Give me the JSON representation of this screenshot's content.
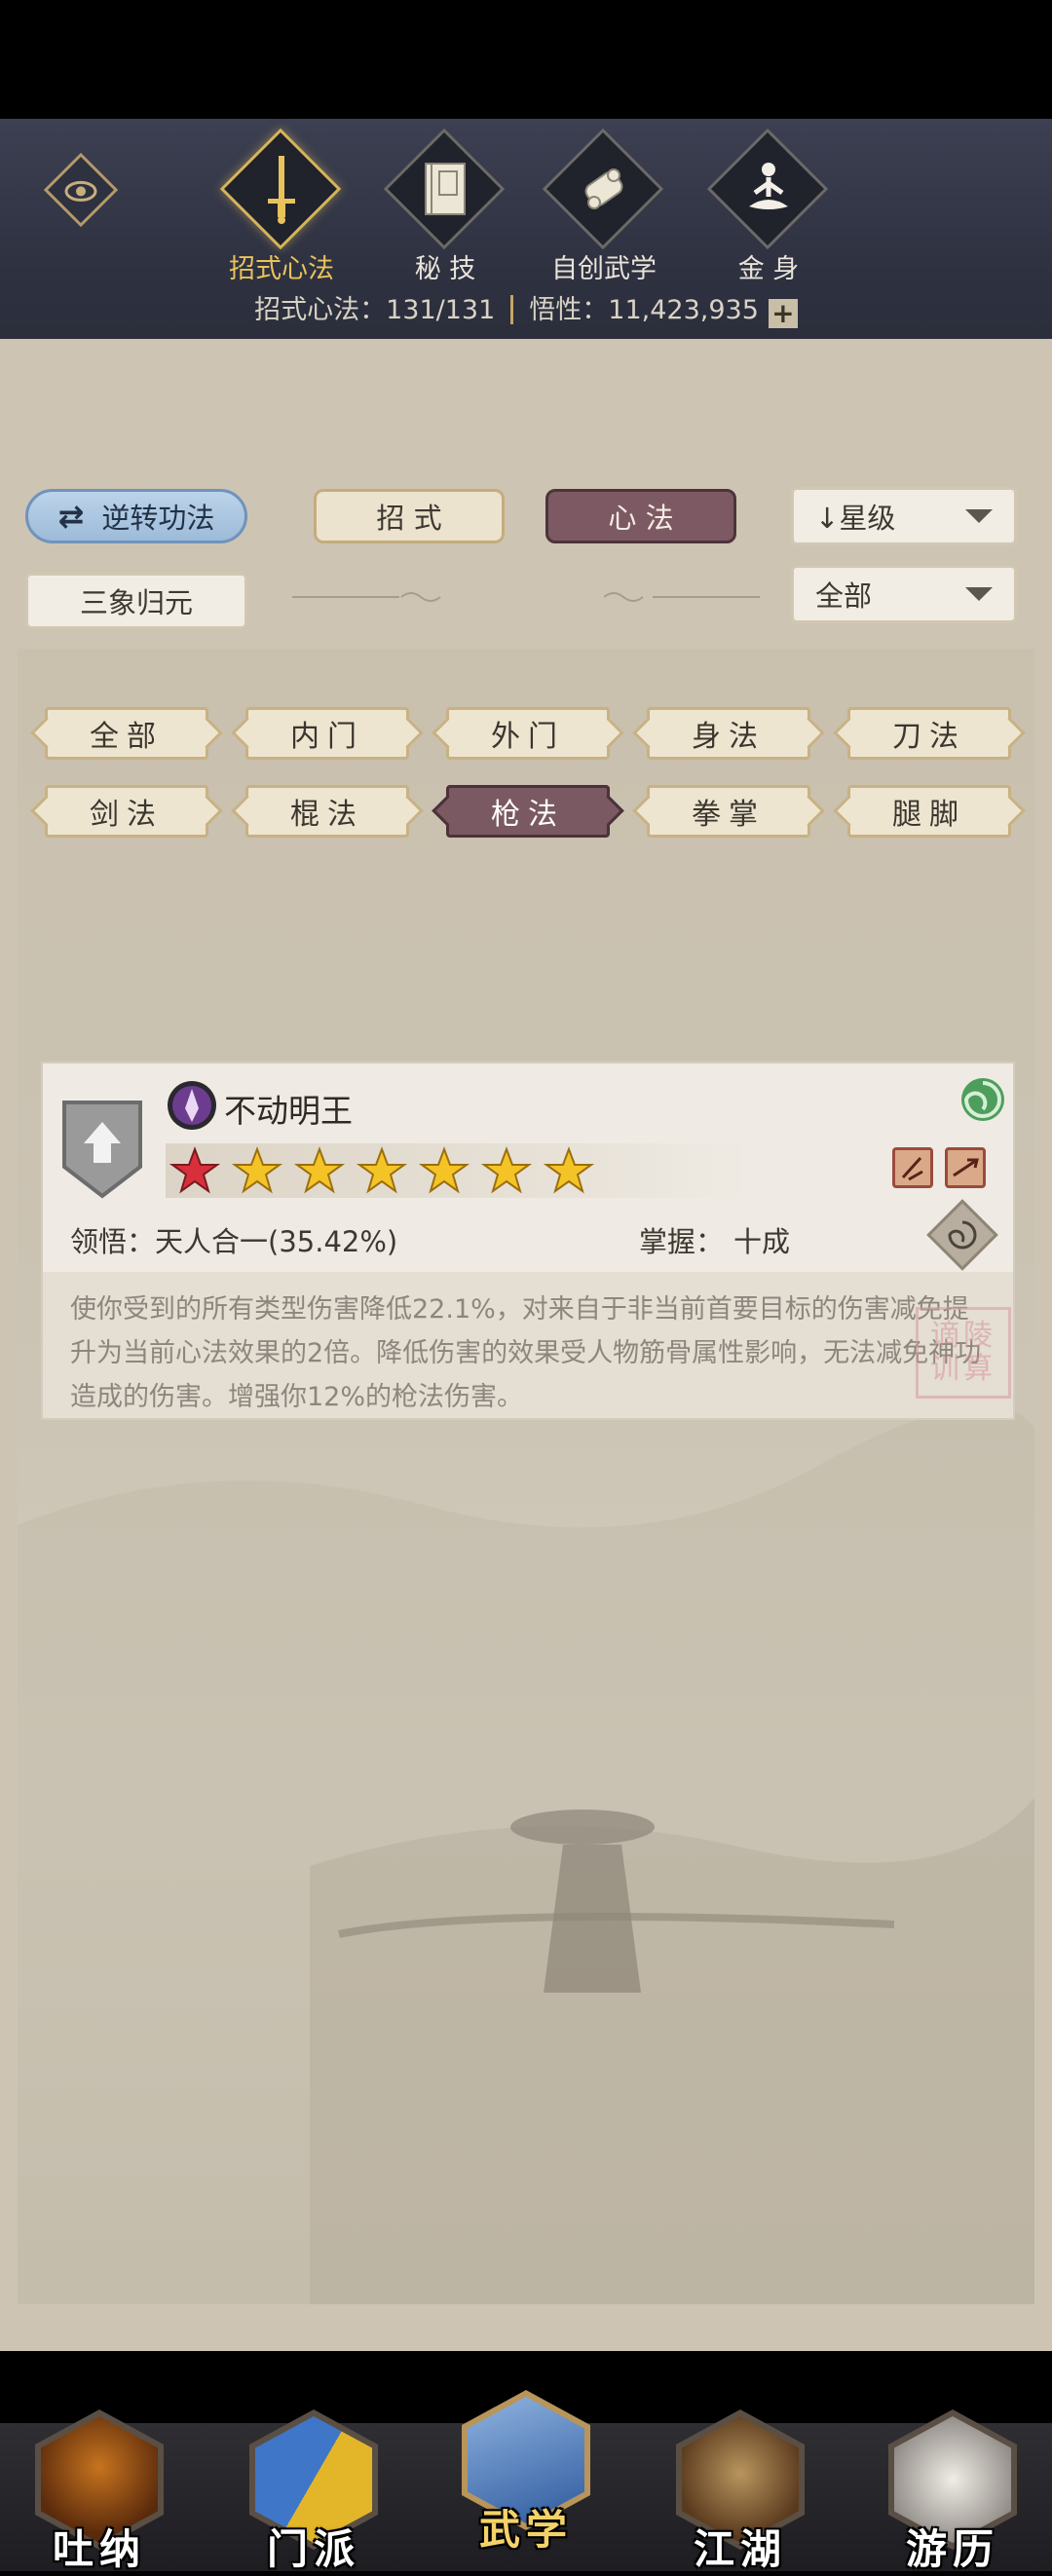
{
  "header": {
    "tabs": [
      {
        "label": "招式心法",
        "icon": "sword-icon",
        "active": true
      },
      {
        "label": "秘 技",
        "icon": "book-icon",
        "active": false
      },
      {
        "label": "自创武学",
        "icon": "scroll-icon",
        "active": false
      },
      {
        "label": "金 身",
        "icon": "meditation-icon",
        "active": false
      }
    ],
    "stats": {
      "moves_label": "招式心法：",
      "moves_value": "131/131",
      "insight_label": "悟性：",
      "insight_value": "11,423,935"
    }
  },
  "controls": {
    "reverse_label": "逆转功法",
    "mode_tabs": [
      {
        "label": "招 式",
        "active": false
      },
      {
        "label": "心 法",
        "active": true
      }
    ],
    "sort_select": "星级",
    "sanxiang_label": "三象归元",
    "filter_select": "全部"
  },
  "categories": [
    {
      "label": "全部",
      "active": false
    },
    {
      "label": "内门",
      "active": false
    },
    {
      "label": "外门",
      "active": false
    },
    {
      "label": "身法",
      "active": false
    },
    {
      "label": "刀法",
      "active": false
    },
    {
      "label": "剑法",
      "active": false
    },
    {
      "label": "棍法",
      "active": false
    },
    {
      "label": "枪法",
      "active": true
    },
    {
      "label": "拳掌",
      "active": false
    },
    {
      "label": "腿脚",
      "active": false
    }
  ],
  "skill": {
    "name": "不动明王",
    "stars": {
      "red": 1,
      "gold": 6
    },
    "comprehension_label": "领悟：",
    "comprehension_value": "天人合一(35.42%)",
    "mastery_label": "掌握：",
    "mastery_value": "十成",
    "description": "使你受到的所有类型伤害降低22.1%，对来自于非当前首要目标的伤害减免提升为当前心法效果的2倍。降低伤害的效果受人物筋骨属性影响，无法减免神功造成的伤害。增强你12%的枪法伤害。",
    "seal_text": "谪陵训算"
  },
  "bottom_nav": [
    {
      "label": "吐纳",
      "icon": "monk-icon",
      "active": false
    },
    {
      "label": "门派",
      "icon": "sect-flags-icon",
      "active": false
    },
    {
      "label": "武学",
      "icon": "manual-books-icon",
      "active": true
    },
    {
      "label": "江湖",
      "icon": "straw-hat-icon",
      "active": false
    },
    {
      "label": "游历",
      "icon": "horse-icon",
      "active": false
    }
  ],
  "colors": {
    "header_bg": "#2e3140",
    "accent_gold": "#d6b45a",
    "active_maroon": "#7a5962",
    "panel_bg": "#cdc4b3"
  }
}
